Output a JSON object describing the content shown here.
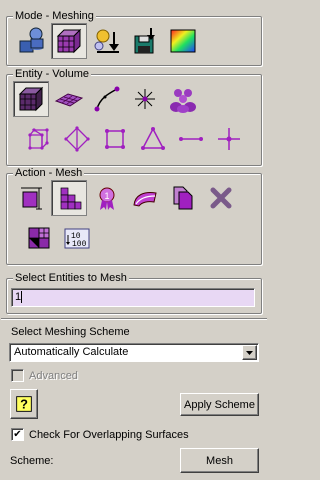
{
  "mode_group": {
    "title": "Mode - Meshing",
    "icons": [
      "geometry-mode-icon",
      "meshing-mode-icon",
      "boundary-conditions-icon",
      "export-icon",
      "analysis-icon"
    ]
  },
  "entity_group": {
    "title": "Entity - Volume",
    "icons": [
      "volume-icon",
      "surface-icon",
      "curve-icon",
      "vertex-icon",
      "group-icon",
      "hex-element-icon",
      "tet-element-icon",
      "quad-element-icon",
      "tri-element-icon",
      "edge-element-icon",
      "node-icon"
    ]
  },
  "action_group": {
    "title": "Action - Mesh",
    "icons": [
      "mesh-size-icon",
      "mesh-scheme-icon",
      "mesh-quality-icon",
      "smooth-mesh-icon",
      "copy-mesh-icon",
      "delete-mesh-icon",
      "refine-mesh-icon",
      "renumber-icon"
    ]
  },
  "entities_group": {
    "title": "Select Entities to Mesh",
    "value": "1"
  },
  "scheme_panel": {
    "title": "Select Meshing Scheme",
    "selected": "Automatically Calculate",
    "advanced_label": "Advanced",
    "apply_label": "Apply Scheme",
    "overlap_label": "Check For Overlapping Surfaces",
    "overlap_checked": "✔",
    "scheme_label": "Scheme:",
    "mesh_label": "Mesh"
  },
  "colors": {
    "accent_purple": "#8800aa",
    "input_highlight": "#e8d8f4"
  }
}
